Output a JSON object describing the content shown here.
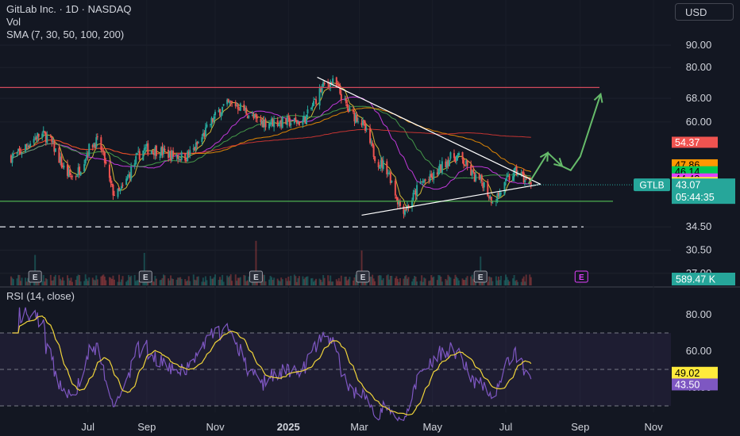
{
  "header": {
    "symbol_line": "GitLab Inc. · 1D · NASDAQ",
    "vol_label": "Vol",
    "sma_label": "SMA (7, 30, 50, 100, 200)",
    "currency": "USD"
  },
  "rsi_panel": {
    "title": "RSI (14, close)"
  },
  "colors": {
    "background": "#131722",
    "up": "#26a69a",
    "down": "#ef5350",
    "rsi_line": "#7e57c2",
    "rsi_ma": "#f0d43a",
    "sma7": "#f0d43a",
    "sma30": "#e040fb",
    "sma50": "#4caf50",
    "sma100": "#ff9800",
    "sma200": "#e53935",
    "resistance": "#d1495b",
    "support": "#4caf50",
    "projection": "#66bb6a"
  },
  "chart_data": [
    {
      "type": "candlestick",
      "symbol": "GTLB",
      "price_scale": "log",
      "ylim": [
        25,
        95
      ],
      "y_ticks": [
        "90.00",
        "80.00",
        "68.00",
        "60.00",
        "34.50",
        "30.50",
        "27.00"
      ],
      "x_ticks": [
        "Jul",
        "Sep",
        "Nov",
        "2025",
        "Mar",
        "May",
        "Jul",
        "Sep",
        "Nov"
      ],
      "last_price_label": "GTLB",
      "last_price": "43.07",
      "countdown": "05:44:35",
      "volume_label": "589.47 K",
      "earnings_markers": [
        "E",
        "E",
        "E",
        "E",
        "E",
        "E"
      ],
      "sma_values": [
        "54.37",
        "47.86",
        "46.14",
        "44.43",
        "43.59"
      ],
      "horizontal_levels": [
        72,
        34.5
      ],
      "support_level": 39.5,
      "pattern": "symmetrical triangle",
      "ohlc_keypoints": [
        {
          "date": "2024-05-15",
          "close": 50
        },
        {
          "date": "2024-06-10",
          "close": 56
        },
        {
          "date": "2024-07-05",
          "close": 45
        },
        {
          "date": "2024-07-25",
          "close": 54
        },
        {
          "date": "2024-08-10",
          "close": 41
        },
        {
          "date": "2024-09-05",
          "close": 52
        },
        {
          "date": "2024-10-05",
          "close": 50
        },
        {
          "date": "2024-11-15",
          "close": 66
        },
        {
          "date": "2024-12-10",
          "close": 60
        },
        {
          "date": "2025-01-10",
          "close": 60
        },
        {
          "date": "2025-02-05",
          "close": 74
        },
        {
          "date": "2025-02-25",
          "close": 62
        },
        {
          "date": "2025-03-20",
          "close": 48
        },
        {
          "date": "2025-04-07",
          "close": 38
        },
        {
          "date": "2025-04-25",
          "close": 44
        },
        {
          "date": "2025-05-20",
          "close": 50
        },
        {
          "date": "2025-06-10",
          "close": 44
        },
        {
          "date": "2025-06-20",
          "close": 40
        },
        {
          "date": "2025-07-10",
          "close": 46
        },
        {
          "date": "2025-07-22",
          "close": 43.07
        }
      ]
    },
    {
      "type": "line",
      "name": "RSI (14, close)",
      "ylim": [
        20,
        85
      ],
      "y_ticks": [
        "80.00",
        "60.00",
        "40.00"
      ],
      "levels": [
        70,
        50,
        30
      ],
      "rsi_ma_value": "49.02",
      "rsi_value": "43.50"
    }
  ]
}
